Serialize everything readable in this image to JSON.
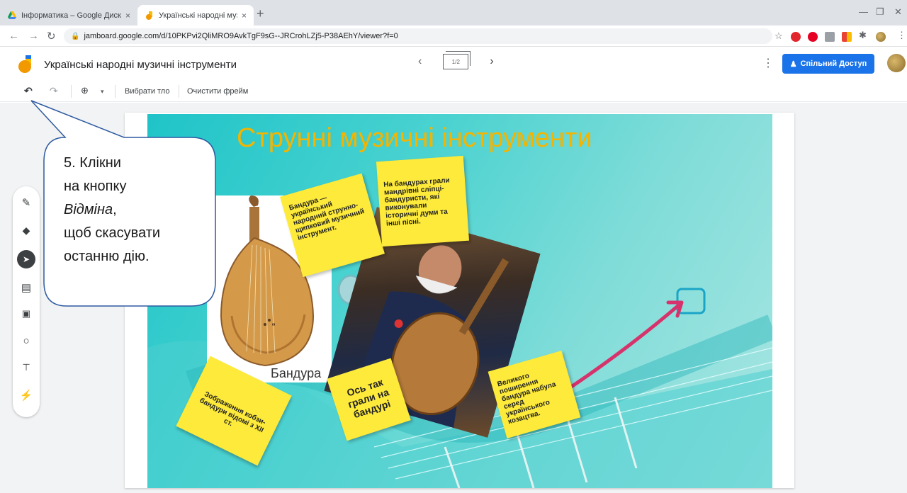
{
  "browser": {
    "tabs": [
      {
        "title": "Інформатика – Google Диск",
        "close": "×"
      },
      {
        "title": "Українські народні музичні інст",
        "close": "×"
      }
    ],
    "new_tab": "+",
    "url": "jamboard.google.com/d/10PKPvi2QliMRO9AvkTgF9sG--JRCrohLZj5-P38AEhY/viewer?f=0"
  },
  "app": {
    "title": "Українські народні музичні інструменти",
    "frame_counter": "1/2",
    "share_label": "Спільний Доступ"
  },
  "toolbar": {
    "background_label": "Вибрати тло",
    "clear_label": "Очистити фрейм"
  },
  "slide": {
    "title": "Струнні музичні інструменти",
    "photo_caption": "Бандура",
    "notes": [
      "Бандура — український народний струнно-щипковий музичний інструмент.",
      "На бандурах грали мандрівні сліпці-бандуристи, які виконували історичні думи та інші пісні.",
      "Зображення кобзи-бандури відомі з XII ст.",
      "Ось так грали на бандурі",
      "Великого поширення бандура набула серед українського козацтва."
    ]
  },
  "callout": {
    "line1": "5. Клікни",
    "line2": "на кнопку",
    "line3": "Відміна",
    "line3_suffix": ",",
    "line4": "щоб скасувати",
    "line5": "останню дію."
  },
  "colors": {
    "share": "#1a73e8",
    "title": "#f4b400",
    "sticky": "#fdea3a",
    "arrow": "#d6336c",
    "canvas": "#3fcfcf"
  }
}
